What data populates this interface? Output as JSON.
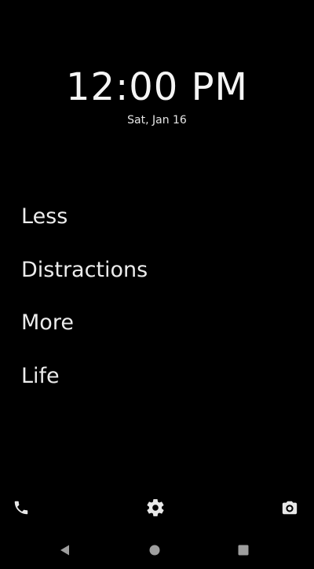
{
  "clock": {
    "time": "12:00 PM",
    "date": "Sat, Jan 16"
  },
  "apps": {
    "items": [
      {
        "label": "Less"
      },
      {
        "label": "Distractions"
      },
      {
        "label": "More"
      },
      {
        "label": "Life"
      }
    ]
  },
  "shortcuts": {
    "left_icon": "phone-icon",
    "center_icon": "gear-icon",
    "right_icon": "camera-icon"
  },
  "navigation": {
    "back_icon": "back-triangle-icon",
    "home_icon": "home-circle-icon",
    "recents_icon": "recents-square-icon"
  },
  "colors": {
    "background": "#000000",
    "text": "#f2f2f2",
    "icon": "#e8e8e8",
    "nav_icon": "#9e9e9e"
  }
}
